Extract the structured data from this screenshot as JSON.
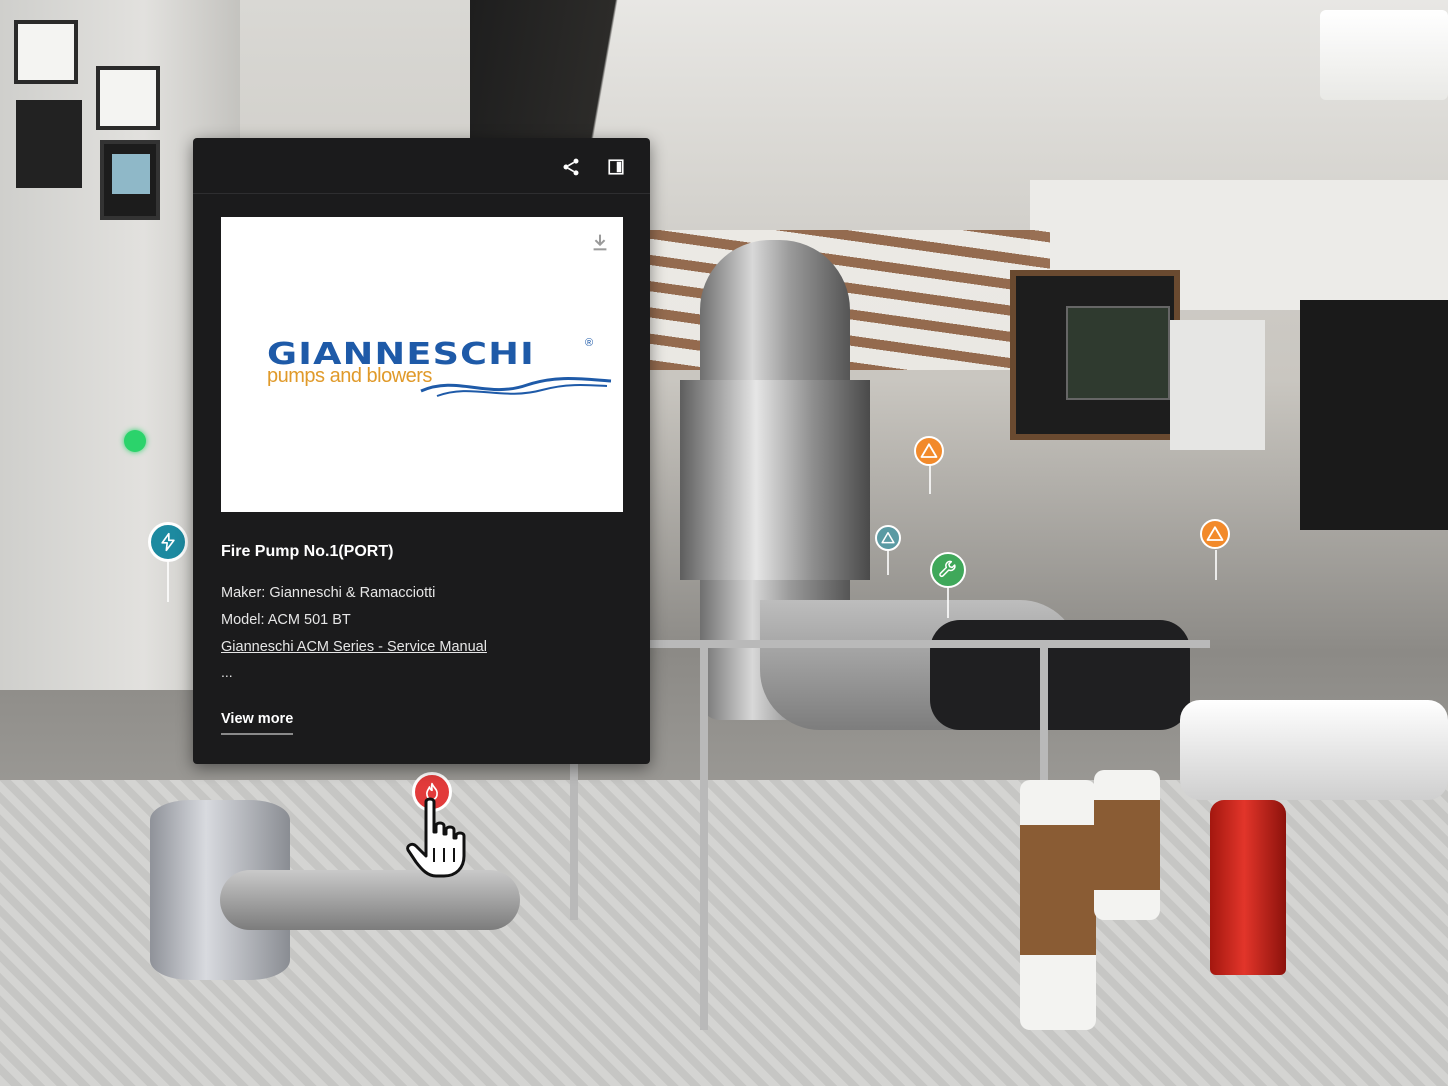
{
  "panel": {
    "title": "Fire Pump No.1(PORT)",
    "maker": "Maker: Gianneschi & Ramacciotti",
    "model": "Model: ACM 501 BT",
    "manual_link": "Gianneschi ACM Series - Service Manual",
    "ellipsis": "...",
    "view_more": "View more",
    "header_icons": [
      "share-icon",
      "layout-icon"
    ],
    "media": {
      "download_icon": "download-icon",
      "logo_wordmark": "GIANNESCHI",
      "logo_registered": "®",
      "logo_tagline": "pumps and blowers"
    }
  },
  "hotspots": [
    {
      "type": "electrical",
      "icon": "lightning-icon",
      "color": "#1d8aa0"
    },
    {
      "type": "warning",
      "icon": "warning-triangle-icon",
      "color": "#f28a2b"
    },
    {
      "type": "warning",
      "icon": "warning-triangle-icon",
      "color": "#5a9aa3"
    },
    {
      "type": "maintenance",
      "icon": "wrench-icon",
      "color": "#3fa85a"
    },
    {
      "type": "warning",
      "icon": "warning-triangle-icon",
      "color": "#f28a2b"
    },
    {
      "type": "fire",
      "icon": "fire-icon",
      "color": "#e23b3b"
    }
  ],
  "cursor": "hand-pointer-icon"
}
